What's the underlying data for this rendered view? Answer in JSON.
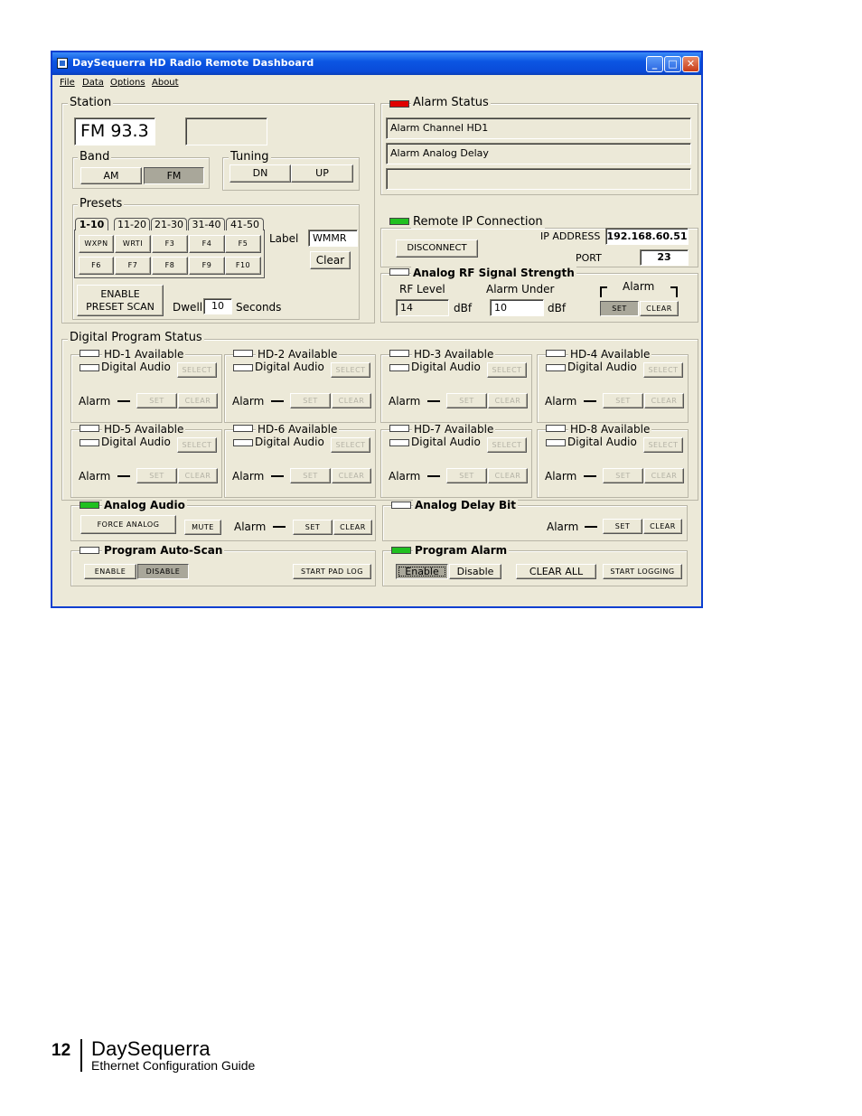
{
  "window": {
    "title": "DaySequerra HD Radio Remote Dashboard"
  },
  "menu": [
    "File",
    "Data",
    "Options",
    "About"
  ],
  "station": {
    "title": "Station",
    "frequency": "FM 93.3",
    "band": {
      "title": "Band",
      "am": "AM",
      "fm": "FM"
    },
    "tuning": {
      "title": "Tuning",
      "dn": "DN",
      "up": "UP"
    },
    "presets": {
      "title": "Presets",
      "tabs": [
        "1-10",
        "11-20",
        "21-30",
        "31-40",
        "41-50"
      ],
      "buttons": [
        "WXPN",
        "WRTI",
        "F3",
        "F4",
        "F5",
        "F6",
        "F7",
        "F8",
        "F9",
        "F10"
      ],
      "label_text": "Label",
      "label_value": "WMMR",
      "clear": "Clear",
      "enable_scan_1": "ENABLE",
      "enable_scan_2": "PRESET SCAN",
      "dwell": "Dwell",
      "dwell_value": "10",
      "seconds": "Seconds"
    }
  },
  "alarm_status": {
    "title": "Alarm Status",
    "led_color": "#e00000",
    "lines": [
      "Alarm Channel HD1",
      "Alarm Analog Delay",
      ""
    ]
  },
  "remote_ip": {
    "title": "Remote IP Connection",
    "disconnect": "DISCONNECT",
    "ip_label": "IP ADDRESS",
    "ip_value": "192.168.60.51",
    "port_label": "PORT",
    "port_value": "23"
  },
  "analog_rf": {
    "title": "Analog RF Signal Strength",
    "rf_level": "RF Level",
    "alarm_under": "Alarm Under",
    "alarm": "Alarm",
    "rf_value": "14",
    "under_value": "10",
    "unit": "dBf",
    "set": "SET",
    "clear": "CLEAR"
  },
  "digital": {
    "title": "Digital Program Status",
    "digital_audio": "Digital Audio",
    "select": "SELECT",
    "alarm": "Alarm",
    "set": "SET",
    "clear": "CLEAR",
    "channels": [
      "HD-1 Available",
      "HD-2 Available",
      "HD-3 Available",
      "HD-4 Available",
      "HD-5 Available",
      "HD-6 Available",
      "HD-7 Available",
      "HD-8 Available"
    ]
  },
  "analog_audio": {
    "title": "Analog Audio",
    "force": "FORCE ANALOG",
    "mute": "MUTE",
    "alarm": "Alarm",
    "set": "SET",
    "clear": "CLEAR"
  },
  "analog_delay": {
    "title": "Analog Delay Bit",
    "alarm": "Alarm",
    "set": "SET",
    "clear": "CLEAR"
  },
  "auto_scan": {
    "title": "Program Auto-Scan",
    "enable": "ENABLE",
    "disable": "DISABLE",
    "start_pad": "START PAD LOG"
  },
  "program_alarm": {
    "title": "Program Alarm",
    "enable": "Enable",
    "disable": "Disable",
    "clear_all": "CLEAR ALL",
    "start_logging": "START LOGGING"
  },
  "footer": {
    "page": "12",
    "brand": "DaySequerra",
    "subtitle": "Ethernet Configuration Guide"
  }
}
